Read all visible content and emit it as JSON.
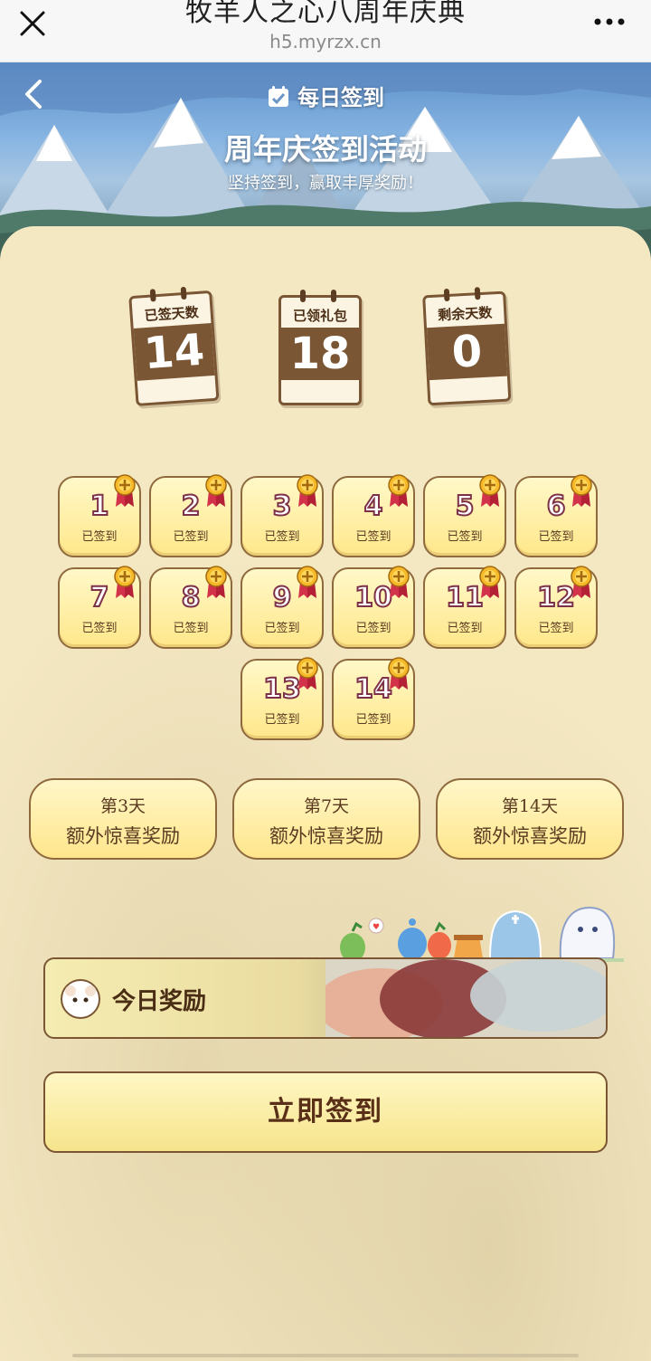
{
  "browser": {
    "title": "牧羊人之心八周年庆典",
    "url": "h5.myrzx.cn"
  },
  "header": {
    "nav_title": "每日签到",
    "heading": "周年庆签到活动",
    "subheading": "坚持签到，赢取丰厚奖励！"
  },
  "stats": [
    {
      "label": "已签天数",
      "value": "14"
    },
    {
      "label": "已领礼包",
      "value": "18"
    },
    {
      "label": "剩余天数",
      "value": "0"
    }
  ],
  "days": [
    {
      "num": "1",
      "status": "已签到"
    },
    {
      "num": "2",
      "status": "已签到"
    },
    {
      "num": "3",
      "status": "已签到"
    },
    {
      "num": "4",
      "status": "已签到"
    },
    {
      "num": "5",
      "status": "已签到"
    },
    {
      "num": "6",
      "status": "已签到"
    },
    {
      "num": "7",
      "status": "已签到"
    },
    {
      "num": "8",
      "status": "已签到"
    },
    {
      "num": "9",
      "status": "已签到"
    },
    {
      "num": "10",
      "status": "已签到"
    },
    {
      "num": "11",
      "status": "已签到"
    },
    {
      "num": "12",
      "status": "已签到"
    },
    {
      "num": "13",
      "status": "已签到"
    },
    {
      "num": "14",
      "status": "已签到"
    }
  ],
  "bonuses": [
    {
      "day": "第3天",
      "text": "额外惊喜奖励"
    },
    {
      "day": "第7天",
      "text": "额外惊喜奖励"
    },
    {
      "day": "第14天",
      "text": "额外惊喜奖励"
    }
  ],
  "today_reward": {
    "label": "今日奖励"
  },
  "signin_button": {
    "label": "立即签到"
  },
  "colors": {
    "brown": "#7a5634",
    "gold": "#ffe78a",
    "sky": "#86b4e2"
  },
  "icons": [
    "close-icon",
    "more-icon",
    "back-icon",
    "calendar-icon",
    "medal-icon",
    "sheep-icon"
  ]
}
